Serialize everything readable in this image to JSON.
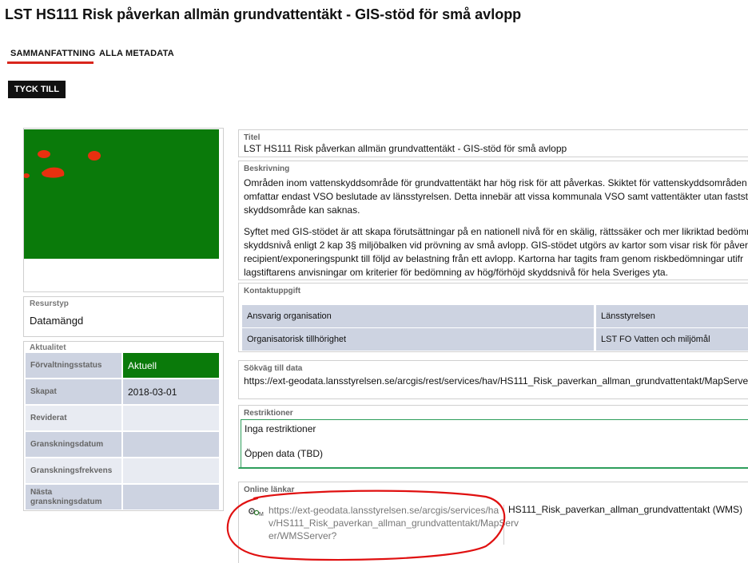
{
  "title": "LST HS111 Risk påverkan allmän grundvattentäkt - GIS-stöd för små avlopp",
  "tabs": [
    {
      "label": "SAMMANFATTNING",
      "active": true
    },
    {
      "label": "ALLA METADATA",
      "active": false
    }
  ],
  "feedback_button": "TYCK TILL",
  "resource_type": {
    "label": "Resurstyp",
    "value": "Datamängd"
  },
  "aktualitet": {
    "label": "Aktualitet",
    "rows": [
      {
        "key": "Förvaltningsstatus",
        "value": "Aktuell"
      },
      {
        "key": "Skapat",
        "value": "2018-03-01"
      },
      {
        "key": "Reviderat",
        "value": ""
      },
      {
        "key": "Granskningsdatum",
        "value": ""
      },
      {
        "key": "Granskningsfrekvens",
        "value": ""
      },
      {
        "key": "Nästa granskningsdatum",
        "value": ""
      }
    ]
  },
  "titel": {
    "label": "Titel",
    "value": "LST HS111 Risk påverkan allmän grundvattentäkt - GIS-stöd för små avlopp"
  },
  "beskrivning": {
    "label": "Beskrivning",
    "paragraph1": [
      "Områden inom vattenskyddsområde för grundvattentäkt har hög risk för att påverkas. Skiktet för vattenskyddsområden",
      "omfattar endast VSO beslutade av länsstyrelsen. Detta innebär att vissa kommunala VSO samt vattentäkter utan fastställ",
      "skyddsområde kan saknas."
    ],
    "paragraph2": [
      "Syftet med GIS-stödet är att skapa förutsättningar på en nationell nivå för en skälig, rättssäker och mer likriktad bedömn",
      "skyddsnivå enligt 2 kap 3§ miljöbalken vid prövning av små avlopp. GIS-stödet utgörs av kartor som visar risk för påverk",
      "recipient/exponeringspunkt till följd av belastning från ett avlopp. Kartorna har tagits fram genom riskbedömningar utifr",
      "lagstiftarens anvisningar om kriterier för bedömning av hög/förhöjd skyddsnivå för hela Sveriges yta."
    ]
  },
  "kontakt": {
    "label": "Kontaktuppgift",
    "rows": [
      {
        "key": "Ansvarig organisation",
        "value": "Länsstyrelsen"
      },
      {
        "key": "Organisatorisk tillhörighet",
        "value": "LST FO Vatten och miljömål"
      }
    ]
  },
  "sokvag": {
    "label": "Sökväg till data",
    "value": "https://ext-geodata.lansstyrelsen.se/arcgis/rest/services/hav/HS111_Risk_paverkan_allman_grundvattentakt/MapServer"
  },
  "restriktioner": {
    "label": "Restriktioner",
    "line1": "Inga restriktioner",
    "line2": "Öppen data (TBD)"
  },
  "online": {
    "label": "Online länkar",
    "url_lines": [
      "https://ext-geodata.lansstyrelsen.se/arcgis/services/ha",
      "v/HS111_Risk_paverkan_allman_grundvattentakt/MapServ",
      "er/WMSServer?"
    ],
    "name": "HS111_Risk_paverkan_allman_grundvattentakt (WMS)"
  },
  "colors": {
    "accent": "#d9261c",
    "status_green": "#0a7a0a",
    "map_green": "#0a7a0a",
    "map_red": "#e8300f",
    "row_blue": "#cdd3e1",
    "row_light": "#e8ebf2",
    "restriction_border": "#2e9e5b"
  },
  "icons": {
    "service_icon": "wms-service-icon"
  }
}
